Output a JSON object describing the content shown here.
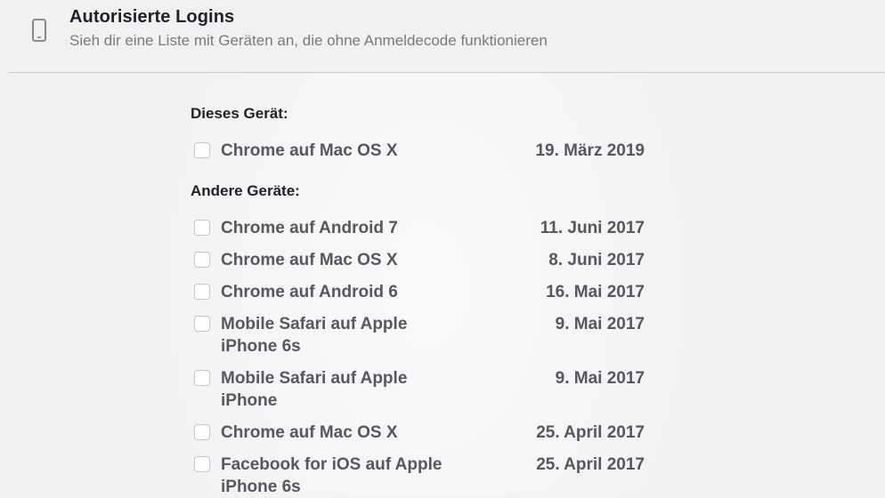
{
  "header": {
    "icon": "mobile-device-icon",
    "title": "Autorisierte Logins",
    "subtitle": "Sieh dir eine Liste mit Geräten an, die ohne Anmeldecode funktionieren"
  },
  "this_device": {
    "label": "Dieses Gerät:",
    "items": [
      {
        "name": "Chrome auf Mac OS X",
        "date": "19. März 2019",
        "checked": false
      }
    ]
  },
  "other_devices": {
    "label": "Andere Geräte:",
    "items": [
      {
        "name": "Chrome auf Android 7",
        "date": "11. Juni 2017",
        "checked": false
      },
      {
        "name": "Chrome auf Mac OS X",
        "date": "8. Juni 2017",
        "checked": false
      },
      {
        "name": "Chrome auf Android 6",
        "date": "16. Mai 2017",
        "checked": false
      },
      {
        "name": "Mobile Safari auf Apple\niPhone 6s",
        "date": "9. Mai 2017",
        "checked": false
      },
      {
        "name": "Mobile Safari auf Apple\niPhone",
        "date": "9. Mai 2017",
        "checked": false
      },
      {
        "name": "Chrome auf Mac OS X",
        "date": "25. April 2017",
        "checked": false
      },
      {
        "name": "Facebook for iOS auf Apple\niPhone 6s",
        "date": "25. April 2017",
        "checked": false
      }
    ]
  },
  "colors": {
    "background": "#f1f1f1",
    "title": "#1d2129",
    "subtitle": "#777a80",
    "item_text": "#555861",
    "checkbox_border": "#c6c6c6"
  }
}
